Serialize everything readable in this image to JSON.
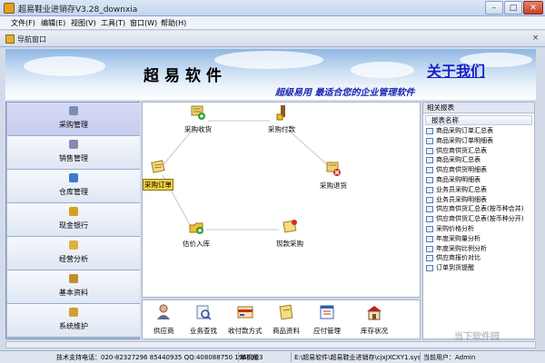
{
  "window": {
    "title": "超易鞋业进销存V3.28_downxia"
  },
  "menu": {
    "items": [
      "文件(F)",
      "编辑(E)",
      "视图(V)",
      "工具(T)",
      "窗口(W)",
      "帮助(H)"
    ]
  },
  "nav": {
    "title": "导航窗口",
    "close": "×"
  },
  "banner": {
    "app_name": "超易软件",
    "about_link": "关于我们",
    "slogan": "超级易用  最适合您的企业管理软件"
  },
  "sidebar": {
    "items": [
      {
        "label": "采购管理",
        "icon": "purchase-icon",
        "color": "#7a8fb8"
      },
      {
        "label": "销售管理",
        "icon": "sales-icon",
        "color": "#8a8ab0"
      },
      {
        "label": "仓库管理",
        "icon": "warehouse-icon",
        "color": "#3d7ad0"
      },
      {
        "label": "现金银行",
        "icon": "cash-icon",
        "color": "#d8a020"
      },
      {
        "label": "经营分析",
        "icon": "analysis-icon",
        "color": "#e0b040"
      },
      {
        "label": "基本资料",
        "icon": "basic-data-icon",
        "color": "#c09030"
      },
      {
        "label": "系统维护",
        "icon": "maintenance-icon",
        "color": "#d0a030"
      }
    ],
    "active_index": 0
  },
  "workspace": {
    "items": [
      {
        "label": "采购收货",
        "icon": "receive-goods-icon"
      },
      {
        "label": "采购付款",
        "icon": "purchase-payment-icon"
      },
      {
        "label": "采购订单",
        "icon": "purchase-order-icon"
      },
      {
        "label": "采购退货",
        "icon": "purchase-return-icon"
      },
      {
        "label": "估价入库",
        "icon": "estimate-stock-in-icon"
      },
      {
        "label": "现款采购",
        "icon": "cash-purchase-icon"
      }
    ]
  },
  "bottombar": {
    "items": [
      {
        "label": "供应商",
        "icon": "supplier-icon"
      },
      {
        "label": "业务查找",
        "icon": "business-search-icon"
      },
      {
        "label": "收付款方式",
        "icon": "payment-method-icon"
      },
      {
        "label": "商品资料",
        "icon": "product-data-icon"
      },
      {
        "label": "应付管理",
        "icon": "payable-icon"
      },
      {
        "label": "库存状况",
        "icon": "inventory-icon"
      }
    ]
  },
  "reports": {
    "header": "相关报表",
    "column": "报表名称",
    "items": [
      "商品采购订单汇总表",
      "商品采购订单明细表",
      "供应商供货汇总表",
      "商品采购汇总表",
      "供应商供货明细表",
      "商品采购明细表",
      "业务员采购汇总表",
      "业务员采购明细表",
      "供应商供货汇总表(按币种合并)",
      "供应商供货汇总表(按币种分开)",
      "采购价格分析",
      "年度采购量分析",
      "年度采购比例分析",
      "供应商报价对比",
      "订单到货提醒"
    ]
  },
  "status": {
    "support": "技术支持电话：020-82327296 85440935 QQ:408088750 1966903",
    "edition": "单机版",
    "path": "E:\\超易软件\\超易鞋业进销存\\cjxJXCXY1.sys",
    "user": "当前用户：Admin"
  },
  "watermark": "当下软件园"
}
